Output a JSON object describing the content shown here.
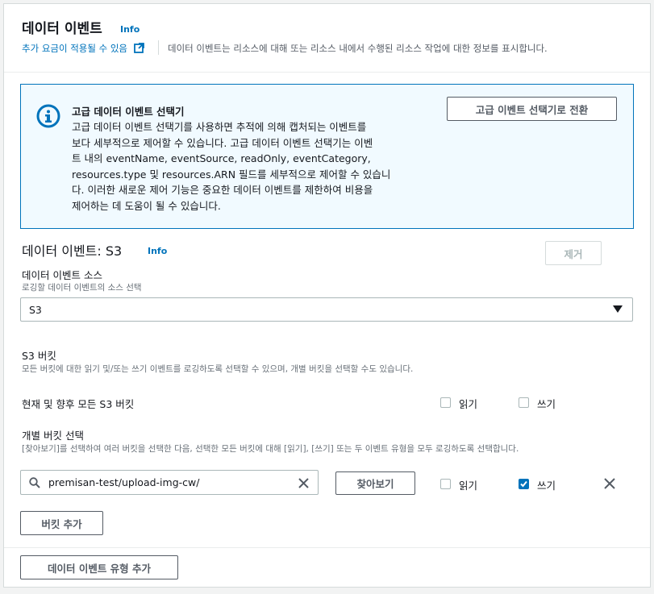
{
  "header": {
    "title": "데이터 이벤트",
    "info": "Info",
    "pricing_link": "추가 요금이 적용될 수 있음",
    "description": "데이터 이벤트는 리소스에 대해 또는 리소스 내에서 수행된 리소스 작업에 대한 정보를 표시합니다."
  },
  "alert": {
    "title": "고급 데이터 이벤트 선택기",
    "lines": [
      "고급 데이터 이벤트 선택기를 사용하면 추적에 의해 캡처되는 이벤트를",
      "보다 세부적으로 제어할 수 있습니다. 고급 데이터 이벤트 선택기는 이벤",
      "트 내의 eventName, eventSource, readOnly, eventCategory,",
      "resources.type 및 resources.ARN 필드를 세부적으로 제어할 수 있습니",
      "다. 이러한 새로운 제어 기능은 중요한 데이터 이벤트를 제한하여 비용을",
      "제어하는 데 도움이 될 수 있습니다."
    ],
    "switch_button": "고급 이벤트 선택기로 전환"
  },
  "section": {
    "title": "데이터 이벤트: S3",
    "info": "Info",
    "remove_button": "제거",
    "source_label": "데이터 이벤트 소스",
    "source_hint": "로깅할 데이터 이벤트의 소스 선택",
    "source_value": "S3"
  },
  "buckets": {
    "title": "S3 버킷",
    "hint": "모든 버킷에 대한 읽기 및/또는 쓰기 이벤트를 로깅하도록 선택할 수 있으며, 개별 버킷을 선택할 수도 있습니다.",
    "all_label": "현재 및 향후 모든 S3 버킷",
    "all_read": {
      "label": "읽기",
      "checked": false
    },
    "all_write": {
      "label": "쓰기",
      "checked": false
    },
    "individual_title": "개별 버킷 선택",
    "individual_hint": "[찾아보기]를 선택하여 여러 버킷을 선택한 다음, 선택한 모든 버킷에 대해 [읽기], [쓰기] 또는 두 이벤트 유형을 모두 로깅하도록 선택합니다.",
    "search_value": "premisan-test/upload-img-cw/",
    "browse_button": "찾아보기",
    "row_read": {
      "label": "읽기",
      "checked": false
    },
    "row_write": {
      "label": "쓰기",
      "checked": true
    },
    "add_bucket_button": "버킷 추가"
  },
  "footer": {
    "add_type_button": "데이터 이벤트 유형 추가"
  }
}
